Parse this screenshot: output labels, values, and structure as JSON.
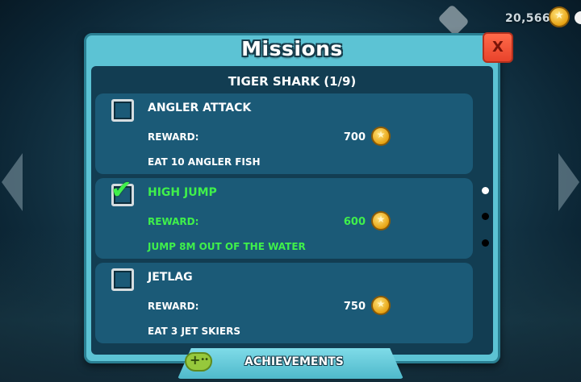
{
  "top_bar": {
    "coins": "20,566",
    "shop_icon": "shop-icon",
    "coin_icon": "coin-icon"
  },
  "panel": {
    "title": "Missions",
    "close_label": "X",
    "subtitle": "TIGER SHARK (1/9)"
  },
  "missions": [
    {
      "name": "ANGLER ATTACK",
      "reward_label": "REWARD:",
      "reward": "700",
      "description": "EAT 10 ANGLER FISH",
      "completed": false
    },
    {
      "name": "HIGH JUMP",
      "reward_label": "REWARD:",
      "reward": "600",
      "description": "JUMP 8M OUT OF THE WATER",
      "completed": true
    },
    {
      "name": "JETLAG",
      "reward_label": "REWARD:",
      "reward": "750",
      "description": "EAT 3 JET SKIERS",
      "completed": false
    }
  ],
  "pagination": {
    "current_page": 1,
    "total_pages": 3
  },
  "achievements": {
    "label": "ACHIEVEMENTS",
    "icon": "gamepad-icon"
  },
  "colors": {
    "panel": "#5cc3d4",
    "card": "#1b5a77",
    "completed_text": "#3ff04b",
    "close_button": "#e8432b",
    "coin": "#e7a313"
  }
}
